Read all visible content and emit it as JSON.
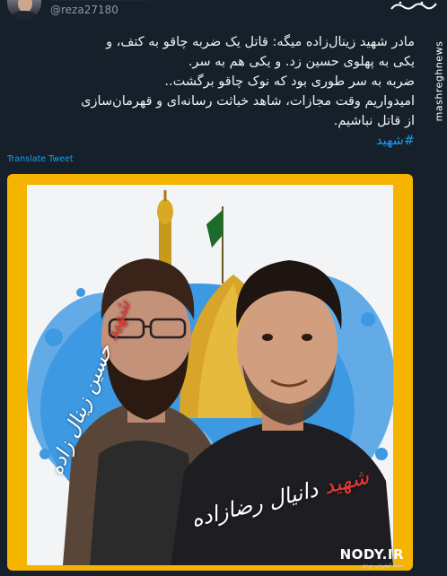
{
  "header": {
    "handle": "@reza27180",
    "watermark": "mashreghnews"
  },
  "tweet": {
    "lines": [
      "مادر شهید زینال‌زاده میگه: قاتل یک ضربه چاقو به کتف، و",
      "یکی به پهلوی حسین زد. و یکی هم به سر.",
      "ضربه به سر طوری بود که نوک چاقو برگشت..",
      "امیدواریم وقت مجازات، شاهد خباثت رسانه‌ای و قهرمان‌سازی",
      "از قاتل نباشیم."
    ],
    "hashtag": "#شهید",
    "translate_label": "Translate Tweet"
  },
  "media": {
    "left_name_prefix": "شهید",
    "left_name": " حسین زینال زاده",
    "right_name_prefix": "شهید",
    "right_name": " دانیال رضازاده",
    "site_watermark": "NODY.IR",
    "site_watermark_sub": "مجله اینترنتی نودی"
  },
  "colors": {
    "background": "#15202b",
    "link": "#1d9bf0",
    "frame": "#f4b400",
    "splash": "#1f8ae0"
  }
}
